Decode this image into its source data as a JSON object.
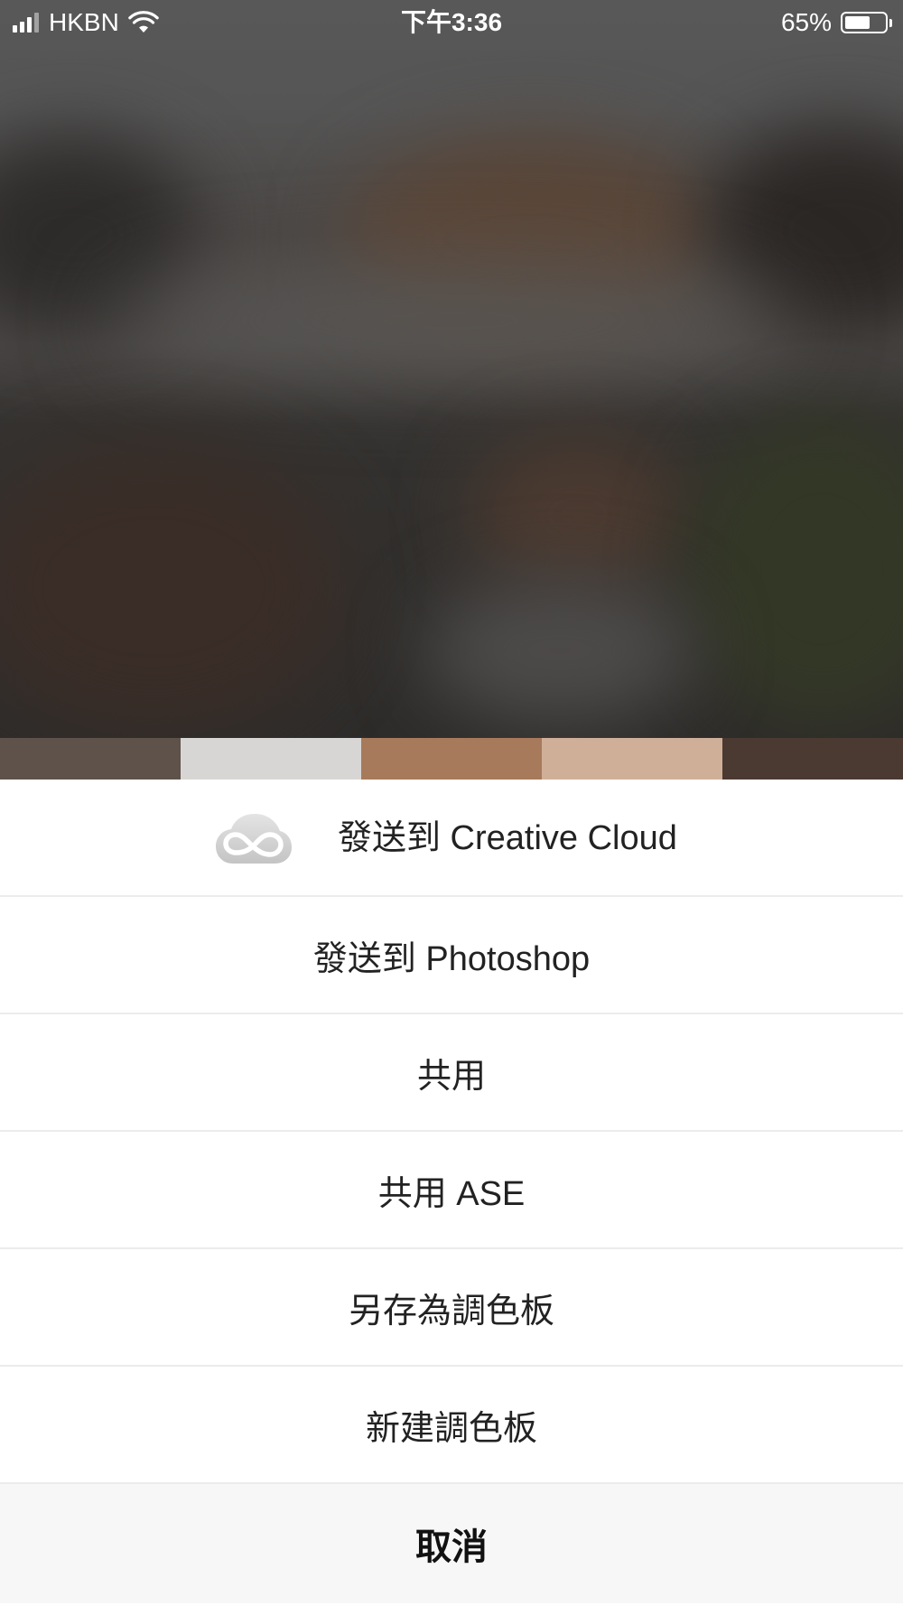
{
  "status_bar": {
    "carrier": "HKBN",
    "time": "下午3:36",
    "battery_percent_label": "65%",
    "battery_level": 0.65,
    "signal_icon": "cellular-signal-icon",
    "wifi_icon": "wifi-icon",
    "battery_icon": "battery-icon"
  },
  "palette": {
    "swatches": [
      "#5f524b",
      "#d8d6d4",
      "#a67a5b",
      "#d0af98",
      "#4a3a32"
    ]
  },
  "action_sheet": {
    "items": [
      {
        "label": "發送到 Creative Cloud",
        "icon": "creative-cloud-icon"
      },
      {
        "label": "發送到 Photoshop"
      },
      {
        "label": "共用"
      },
      {
        "label": "共用 ASE"
      },
      {
        "label": "另存為調色板"
      },
      {
        "label": "新建調色板"
      }
    ],
    "cancel_label": "取消"
  }
}
